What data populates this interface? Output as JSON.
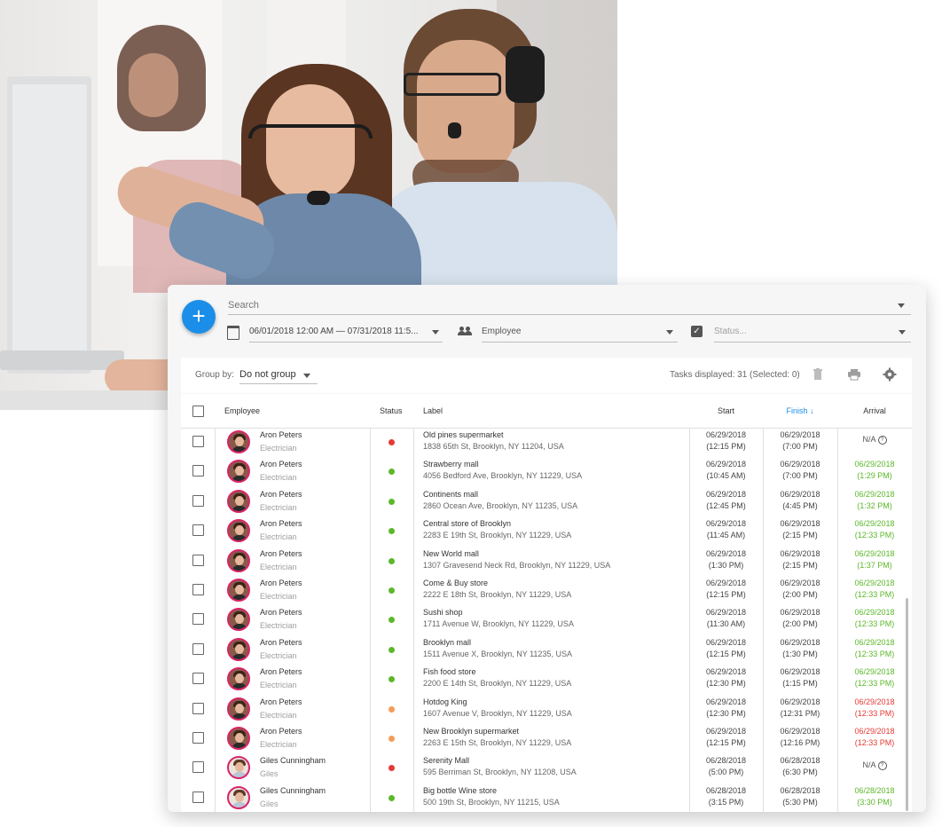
{
  "search": {
    "placeholder": "Search"
  },
  "filters": {
    "date_range": "06/01/2018 12:00 AM — 07/31/2018 11:5...",
    "employee": "Employee",
    "status": "Status..."
  },
  "toolbar": {
    "group_by_label": "Group by:",
    "group_by_value": "Do not group",
    "tasks_displayed": "Tasks displayed: 31 (Selected: 0)"
  },
  "columns": {
    "employee": "Employee",
    "status": "Status",
    "label": "Label",
    "start": "Start",
    "finish": "Finish",
    "finish_sort": "↓",
    "arrival": "Arrival"
  },
  "colors": {
    "accent": "#1a8ee8",
    "status_red": "#e53935",
    "status_green": "#5cb82a",
    "status_orange": "#f59c5a",
    "arrival_green": "#5cb82a",
    "arrival_red": "#e53935"
  },
  "rows": [
    {
      "name": "Aron Peters",
      "role": "Electrician",
      "status": "red",
      "label": "Old pines supermarket",
      "address": "1838 65th St, Brooklyn, NY 11204, USA",
      "start_date": "06/29/2018",
      "start_time": "(12:15 PM)",
      "finish_date": "06/29/2018",
      "finish_time": "(7:00 PM)",
      "arrival_date": "N/A",
      "arrival_time": "",
      "arrival_state": "na"
    },
    {
      "name": "Aron Peters",
      "role": "Electrician",
      "status": "green",
      "label": "Strawberry mall",
      "address": "4056 Bedford Ave, Brooklyn, NY 11229, USA",
      "start_date": "06/29/2018",
      "start_time": "(10:45 AM)",
      "finish_date": "06/29/2018",
      "finish_time": "(7:00 PM)",
      "arrival_date": "06/29/2018",
      "arrival_time": "(1:29 PM)",
      "arrival_state": "green"
    },
    {
      "name": "Aron Peters",
      "role": "Electrician",
      "status": "green",
      "label": "Continents mall",
      "address": "2860 Ocean Ave, Brooklyn, NY 11235, USA",
      "start_date": "06/29/2018",
      "start_time": "(12:45 PM)",
      "finish_date": "06/29/2018",
      "finish_time": "(4:45 PM)",
      "arrival_date": "06/29/2018",
      "arrival_time": "(1:32 PM)",
      "arrival_state": "green"
    },
    {
      "name": "Aron Peters",
      "role": "Electrician",
      "status": "green",
      "label": "Central store of Brooklyn",
      "address": "2283 E 19th St, Brooklyn, NY 11229, USA",
      "start_date": "06/29/2018",
      "start_time": "(11:45 AM)",
      "finish_date": "06/29/2018",
      "finish_time": "(2:15 PM)",
      "arrival_date": "06/29/2018",
      "arrival_time": "(12:33 PM)",
      "arrival_state": "green"
    },
    {
      "name": "Aron Peters",
      "role": "Electrician",
      "status": "green",
      "label": "New World mall",
      "address": "1307 Gravesend Neck Rd, Brooklyn, NY 11229, USA",
      "start_date": "06/29/2018",
      "start_time": "(1:30 PM)",
      "finish_date": "06/29/2018",
      "finish_time": "(2:15 PM)",
      "arrival_date": "06/29/2018",
      "arrival_time": "(1:37 PM)",
      "arrival_state": "green"
    },
    {
      "name": "Aron Peters",
      "role": "Electrician",
      "status": "green",
      "label": "Come & Buy store",
      "address": "2222 E 18th St, Brooklyn, NY 11229, USA",
      "start_date": "06/29/2018",
      "start_time": "(12:15 PM)",
      "finish_date": "06/29/2018",
      "finish_time": "(2:00 PM)",
      "arrival_date": "06/29/2018",
      "arrival_time": "(12:33 PM)",
      "arrival_state": "green"
    },
    {
      "name": "Aron Peters",
      "role": "Electrician",
      "status": "green",
      "label": "Sushi shop",
      "address": "1711 Avenue W, Brooklyn, NY 11229, USA",
      "start_date": "06/29/2018",
      "start_time": "(11:30 AM)",
      "finish_date": "06/29/2018",
      "finish_time": "(2:00 PM)",
      "arrival_date": "06/29/2018",
      "arrival_time": "(12:33 PM)",
      "arrival_state": "green"
    },
    {
      "name": "Aron Peters",
      "role": "Electrician",
      "status": "green",
      "label": "Brooklyn mall",
      "address": "1511 Avenue X, Brooklyn, NY 11235, USA",
      "start_date": "06/29/2018",
      "start_time": "(12:15 PM)",
      "finish_date": "06/29/2018",
      "finish_time": "(1:30 PM)",
      "arrival_date": "06/29/2018",
      "arrival_time": "(12:33 PM)",
      "arrival_state": "green"
    },
    {
      "name": "Aron Peters",
      "role": "Electrician",
      "status": "green",
      "label": "Fish food store",
      "address": "2200 E 14th St, Brooklyn, NY 11229, USA",
      "start_date": "06/29/2018",
      "start_time": "(12:30 PM)",
      "finish_date": "06/29/2018",
      "finish_time": "(1:15 PM)",
      "arrival_date": "06/29/2018",
      "arrival_time": "(12:33 PM)",
      "arrival_state": "green"
    },
    {
      "name": "Aron Peters",
      "role": "Electrician",
      "status": "orange",
      "label": "Hotdog King",
      "address": "1607 Avenue V, Brooklyn, NY 11229, USA",
      "start_date": "06/29/2018",
      "start_time": "(12:30 PM)",
      "finish_date": "06/29/2018",
      "finish_time": "(12:31 PM)",
      "arrival_date": "06/29/2018",
      "arrival_time": "(12:33 PM)",
      "arrival_state": "red"
    },
    {
      "name": "Aron Peters",
      "role": "Electrician",
      "status": "orange",
      "label": "New Brooklyn supermarket",
      "address": "2263 E 15th St, Brooklyn, NY 11229, USA",
      "start_date": "06/29/2018",
      "start_time": "(12:15 PM)",
      "finish_date": "06/29/2018",
      "finish_time": "(12:16 PM)",
      "arrival_date": "06/29/2018",
      "arrival_time": "(12:33 PM)",
      "arrival_state": "red"
    },
    {
      "name": "Giles Cunningham",
      "role": "Giles",
      "status": "red",
      "label": "Serenity Mall",
      "address": "595 Berriman St, Brooklyn, NY 11208, USA",
      "start_date": "06/28/2018",
      "start_time": "(5:00 PM)",
      "finish_date": "06/28/2018",
      "finish_time": "(6:30 PM)",
      "arrival_date": "N/A",
      "arrival_time": "",
      "arrival_state": "na"
    },
    {
      "name": "Giles Cunningham",
      "role": "Giles",
      "status": "green",
      "label": "Big bottle Wine store",
      "address": "500 19th St, Brooklyn, NY 11215, USA",
      "start_date": "06/28/2018",
      "start_time": "(3:15 PM)",
      "finish_date": "06/28/2018",
      "finish_time": "(5:30 PM)",
      "arrival_date": "06/28/2018",
      "arrival_time": "(3:30 PM)",
      "arrival_state": "green"
    }
  ]
}
